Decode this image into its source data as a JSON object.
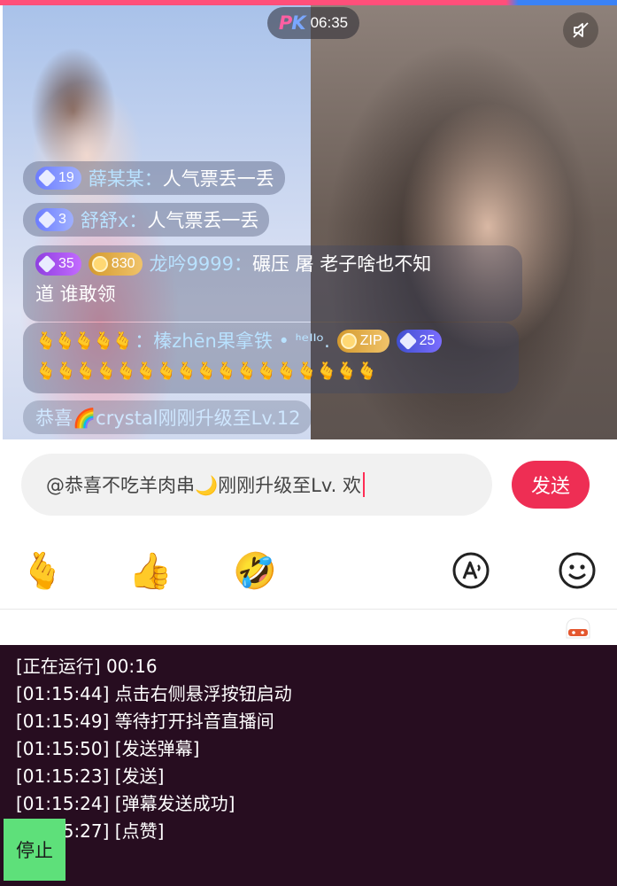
{
  "pk_bar": {
    "logo": "PK",
    "timer": "06:35"
  },
  "icons": {
    "mute": "speaker-muted-icon",
    "emoji_smile": "smiley-face-icon",
    "text_to_speech": "a-speech-icon"
  },
  "chat": {
    "messages": [
      {
        "level": "19",
        "name": "薛某某：",
        "text": "人气票丢一丢"
      },
      {
        "level": "3",
        "name": "舒舒x：",
        "text": "人气票丢一丢"
      },
      {
        "level": "35",
        "coin": "830",
        "name": "龙吟9999：",
        "text": "碾压 屠 老子啥也不知",
        "text2": "道 谁敢领"
      },
      {
        "name": "：榛zhēn果拿铁 • ᑋᵉᑊᑊᵒ.",
        "fan_badge": "ZIP",
        "level": "25",
        "hands_top": "🫰🫰🫰🫰🫰",
        "hands_bottom": "🫰🫰🫰🫰🫰🫰🫰🫰🫰🫰🫰🫰🫰🫰🫰🫰🫰"
      },
      {
        "text": "恭喜🌈crystal刚刚升级至Lv.12"
      }
    ]
  },
  "composer": {
    "value": "@恭喜不吃羊肉串🌙刚刚升级至Lv. 欢",
    "send_label": "发送"
  },
  "emoji_bar": [
    "🫰",
    "👍",
    "🤣"
  ],
  "log": {
    "lines": [
      "[正在运行] 00:16",
      "[01:15:44] 点击右侧悬浮按钮启动",
      "[01:15:49] 等待打开抖音直播间",
      "[01:15:50] [发送弹幕]",
      "[01:15:23] [发送]",
      "[01:15:24] [弹幕发送成功]",
      "[01:15:27] [点赞]"
    ],
    "stop_label": "停止"
  },
  "colors": {
    "accent": "#ee2e54",
    "log_bg": "#270d20",
    "stop_bg": "#5ee07a"
  }
}
